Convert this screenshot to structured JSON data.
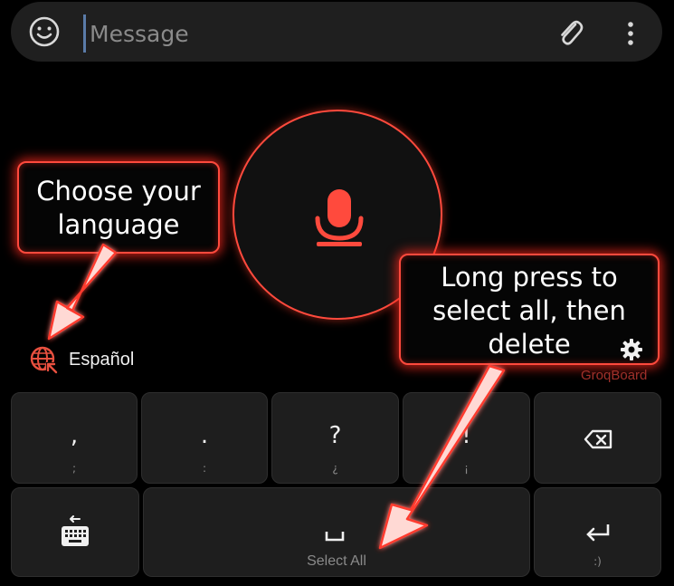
{
  "message_bar": {
    "placeholder": "Message",
    "emoji_icon": "smiley-icon",
    "attach_icon": "paperclip-icon",
    "more_icon": "more-vertical-icon"
  },
  "voice": {
    "mic_icon": "microphone-icon"
  },
  "annotations": {
    "language_callout": [
      "Choose your",
      "language"
    ],
    "delete_callout": [
      "Long press to",
      "select all, then",
      "delete"
    ]
  },
  "language": {
    "icon": "globe-icon",
    "label": "Español"
  },
  "settings_icon": "gear-icon",
  "brand": "GroqBoard",
  "keyboard": {
    "row1": [
      {
        "main": ",",
        "sub": ";"
      },
      {
        "main": ".",
        "sub": ":"
      },
      {
        "main": "?",
        "sub": "¿"
      },
      {
        "main": "!",
        "sub": "¡"
      },
      {
        "icon": "backspace-icon"
      }
    ],
    "row2": {
      "keyboard_switch_icon": "keyboard-icon",
      "space_label": "Select All",
      "enter_icon": "enter-icon",
      "enter_sub": ":)"
    }
  },
  "colors": {
    "accent": "#ff4a3d",
    "key_bg": "#1e1e1e",
    "bar_bg": "#1f1f1f"
  }
}
